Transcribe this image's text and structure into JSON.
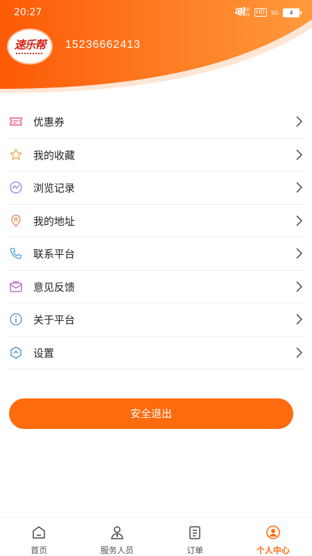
{
  "status_bar": {
    "time": "20:27",
    "net_speed_top": "0.30",
    "net_speed_bottom": "KB/s",
    "hd": "HD",
    "signal": "5G",
    "battery": "4"
  },
  "profile": {
    "phone": "15236662413",
    "logo_text": "速乐帮"
  },
  "menu": {
    "items": [
      {
        "label": "优惠券",
        "icon": "coupon-icon"
      },
      {
        "label": "我的收藏",
        "icon": "star-icon"
      },
      {
        "label": "浏览记录",
        "icon": "history-icon"
      },
      {
        "label": "我的地址",
        "icon": "location-icon"
      },
      {
        "label": "联系平台",
        "icon": "phone-icon"
      },
      {
        "label": "意见反馈",
        "icon": "feedback-icon"
      },
      {
        "label": "关于平台",
        "icon": "info-icon"
      },
      {
        "label": "设置",
        "icon": "settings-icon"
      }
    ]
  },
  "logout_label": "安全退出",
  "tabs": [
    {
      "label": "首页",
      "icon": "home-icon"
    },
    {
      "label": "服务人员",
      "icon": "staff-icon"
    },
    {
      "label": "订单",
      "icon": "order-icon"
    },
    {
      "label": "个人中心",
      "icon": "profile-icon",
      "active": true
    }
  ],
  "colors": {
    "accent": "#fe6a0e",
    "header_gradient_start": "#fd5a06",
    "header_gradient_end": "#ff9a3c"
  }
}
